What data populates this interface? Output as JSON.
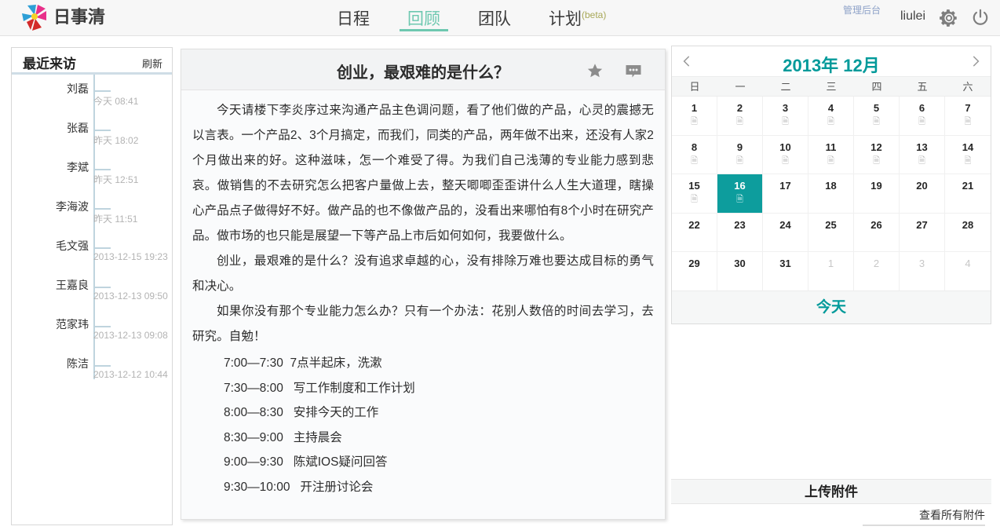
{
  "header": {
    "logo_text": "日事清",
    "logo_icon": "pinwheel-logo-icon",
    "nav": [
      {
        "label": "日程",
        "active": false
      },
      {
        "label": "回顾",
        "active": true
      },
      {
        "label": "团队",
        "active": false
      },
      {
        "label": "计划",
        "suffix": "(beta)",
        "active": false
      }
    ],
    "admin_link": "管理后台",
    "username": "liulei",
    "gear_icon": "gear-icon",
    "power_icon": "power-icon"
  },
  "sidebar": {
    "title": "最近来访",
    "refresh": "刷新",
    "visitors": [
      {
        "name": "刘磊",
        "time": "今天 08:41"
      },
      {
        "name": "张磊",
        "time": "昨天 18:02"
      },
      {
        "name": "李斌",
        "time": "昨天 12:51"
      },
      {
        "name": "李海波",
        "time": "昨天 11:51"
      },
      {
        "name": "毛文强",
        "time": "2013-12-15 19:23"
      },
      {
        "name": "王嘉良",
        "time": "2013-12-13 09:50"
      },
      {
        "name": "范家玮",
        "time": "2013-12-13 09:08"
      },
      {
        "name": "陈洁",
        "time": "2013-12-12 10:44"
      }
    ]
  },
  "main": {
    "title": "创业，最艰难的是什么？",
    "star_icon": "star-icon",
    "comment_icon": "comment-bubble-icon",
    "paragraphs": [
      "今天请楼下李炎序过来沟通产品主色调问题，看了他们做的产品，心灵的震撼无以言表。一个产品2、3个月搞定，而我们，同类的产品，两年做不出来，还没有人家2个月做出来的好。这种滋味，怎一个难受了得。为我们自己浅薄的专业能力感到悲哀。做销售的不去研究怎么把客户量做上去，整天唧唧歪歪讲什么人生大道理，瞎操心产品点子做得好不好。做产品的也不像做产品的，没看出来哪怕有8个小时在研究产品。做市场的也只能是展望一下等产品上市后如何如何，我要做什么。",
      "创业，最艰难的是什么？没有追求卓越的心，没有排除万难也要达成目标的勇气和决心。",
      "如果你没有那个专业能力怎么办？只有一个办法：花别人数倍的时间去学习，去研究。自勉！"
    ],
    "schedule": [
      "7:00—7:30  7点半起床，洗漱",
      "7:30—8:00   写工作制度和工作计划",
      "8:00—8:30   安排今天的工作",
      "8:30—9:00   主持晨会",
      "",
      "9:00—9:30   陈斌IOS疑问回答",
      "9:30—10:00   开注册讨论会"
    ]
  },
  "calendar": {
    "month_label": "2013年 12月",
    "prev_icon": "chevron-left-icon",
    "next_icon": "chevron-right-icon",
    "dow": [
      "日",
      "一",
      "二",
      "三",
      "四",
      "五",
      "六"
    ],
    "today_label": "今天",
    "selected_day": 16,
    "accent_color": "#0d9d9d",
    "cells": [
      {
        "d": 1,
        "muted": false,
        "doc": true
      },
      {
        "d": 2,
        "muted": false,
        "doc": true
      },
      {
        "d": 3,
        "muted": false,
        "doc": true
      },
      {
        "d": 4,
        "muted": false,
        "doc": true
      },
      {
        "d": 5,
        "muted": false,
        "doc": true
      },
      {
        "d": 6,
        "muted": false,
        "doc": true
      },
      {
        "d": 7,
        "muted": false,
        "doc": true
      },
      {
        "d": 8,
        "muted": false,
        "doc": true
      },
      {
        "d": 9,
        "muted": false,
        "doc": true
      },
      {
        "d": 10,
        "muted": false,
        "doc": true
      },
      {
        "d": 11,
        "muted": false,
        "doc": true
      },
      {
        "d": 12,
        "muted": false,
        "doc": true
      },
      {
        "d": 13,
        "muted": false,
        "doc": true
      },
      {
        "d": 14,
        "muted": false,
        "doc": true
      },
      {
        "d": 15,
        "muted": false,
        "doc": true
      },
      {
        "d": 16,
        "muted": false,
        "doc": true,
        "sel": true
      },
      {
        "d": 17,
        "muted": false,
        "doc": false
      },
      {
        "d": 18,
        "muted": false,
        "doc": false
      },
      {
        "d": 19,
        "muted": false,
        "doc": false
      },
      {
        "d": 20,
        "muted": false,
        "doc": false
      },
      {
        "d": 21,
        "muted": false,
        "doc": false
      },
      {
        "d": 22,
        "muted": false,
        "doc": false
      },
      {
        "d": 23,
        "muted": false,
        "doc": false
      },
      {
        "d": 24,
        "muted": false,
        "doc": false
      },
      {
        "d": 25,
        "muted": false,
        "doc": false
      },
      {
        "d": 26,
        "muted": false,
        "doc": false
      },
      {
        "d": 27,
        "muted": false,
        "doc": false
      },
      {
        "d": 28,
        "muted": false,
        "doc": false
      },
      {
        "d": 29,
        "muted": false,
        "doc": false
      },
      {
        "d": 30,
        "muted": false,
        "doc": false
      },
      {
        "d": 31,
        "muted": false,
        "doc": false
      },
      {
        "d": 1,
        "muted": true,
        "doc": false
      },
      {
        "d": 2,
        "muted": true,
        "doc": false
      },
      {
        "d": 3,
        "muted": true,
        "doc": false
      },
      {
        "d": 4,
        "muted": true,
        "doc": false
      }
    ]
  },
  "attachments": {
    "title": "上传附件",
    "view_all": "查看所有附件"
  }
}
